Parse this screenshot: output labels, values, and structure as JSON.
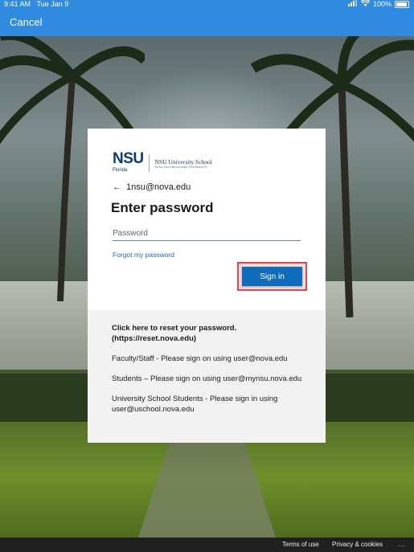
{
  "status_bar": {
    "time": "9:41 AM",
    "date": "Tue Jan 9",
    "battery": "100%"
  },
  "nav": {
    "cancel_label": "Cancel"
  },
  "logo": {
    "brand": "NSU",
    "subbrand": "Florida",
    "school": "NSU University School",
    "school_tagline": "NOVA SOUTHEASTERN UNIVERSITY"
  },
  "login": {
    "back_email": "1nsu@nova.edu",
    "title": "Enter password",
    "password_placeholder": "Password",
    "password_value": "",
    "forgot_link": "Forgot my password",
    "signin_label": "Sign in"
  },
  "info": {
    "reset_line1": "Click here to reset your password.",
    "reset_line2": "(https://reset.nova.edu)",
    "faculty": "Faculty/Staff - Please sign on using user@nova.edu",
    "students": "Students – Please sign on using user@mynsu.nova.edu",
    "school_students": "University School Students - Please sign in using user@uschool.nova.edu"
  },
  "footer": {
    "terms": "Terms of use",
    "privacy": "Privacy & cookies",
    "more": "..."
  },
  "colors": {
    "accent": "#2f8ae0",
    "button": "#0f6cbd",
    "highlight": "#e0474c",
    "link": "#1f6bc2"
  }
}
